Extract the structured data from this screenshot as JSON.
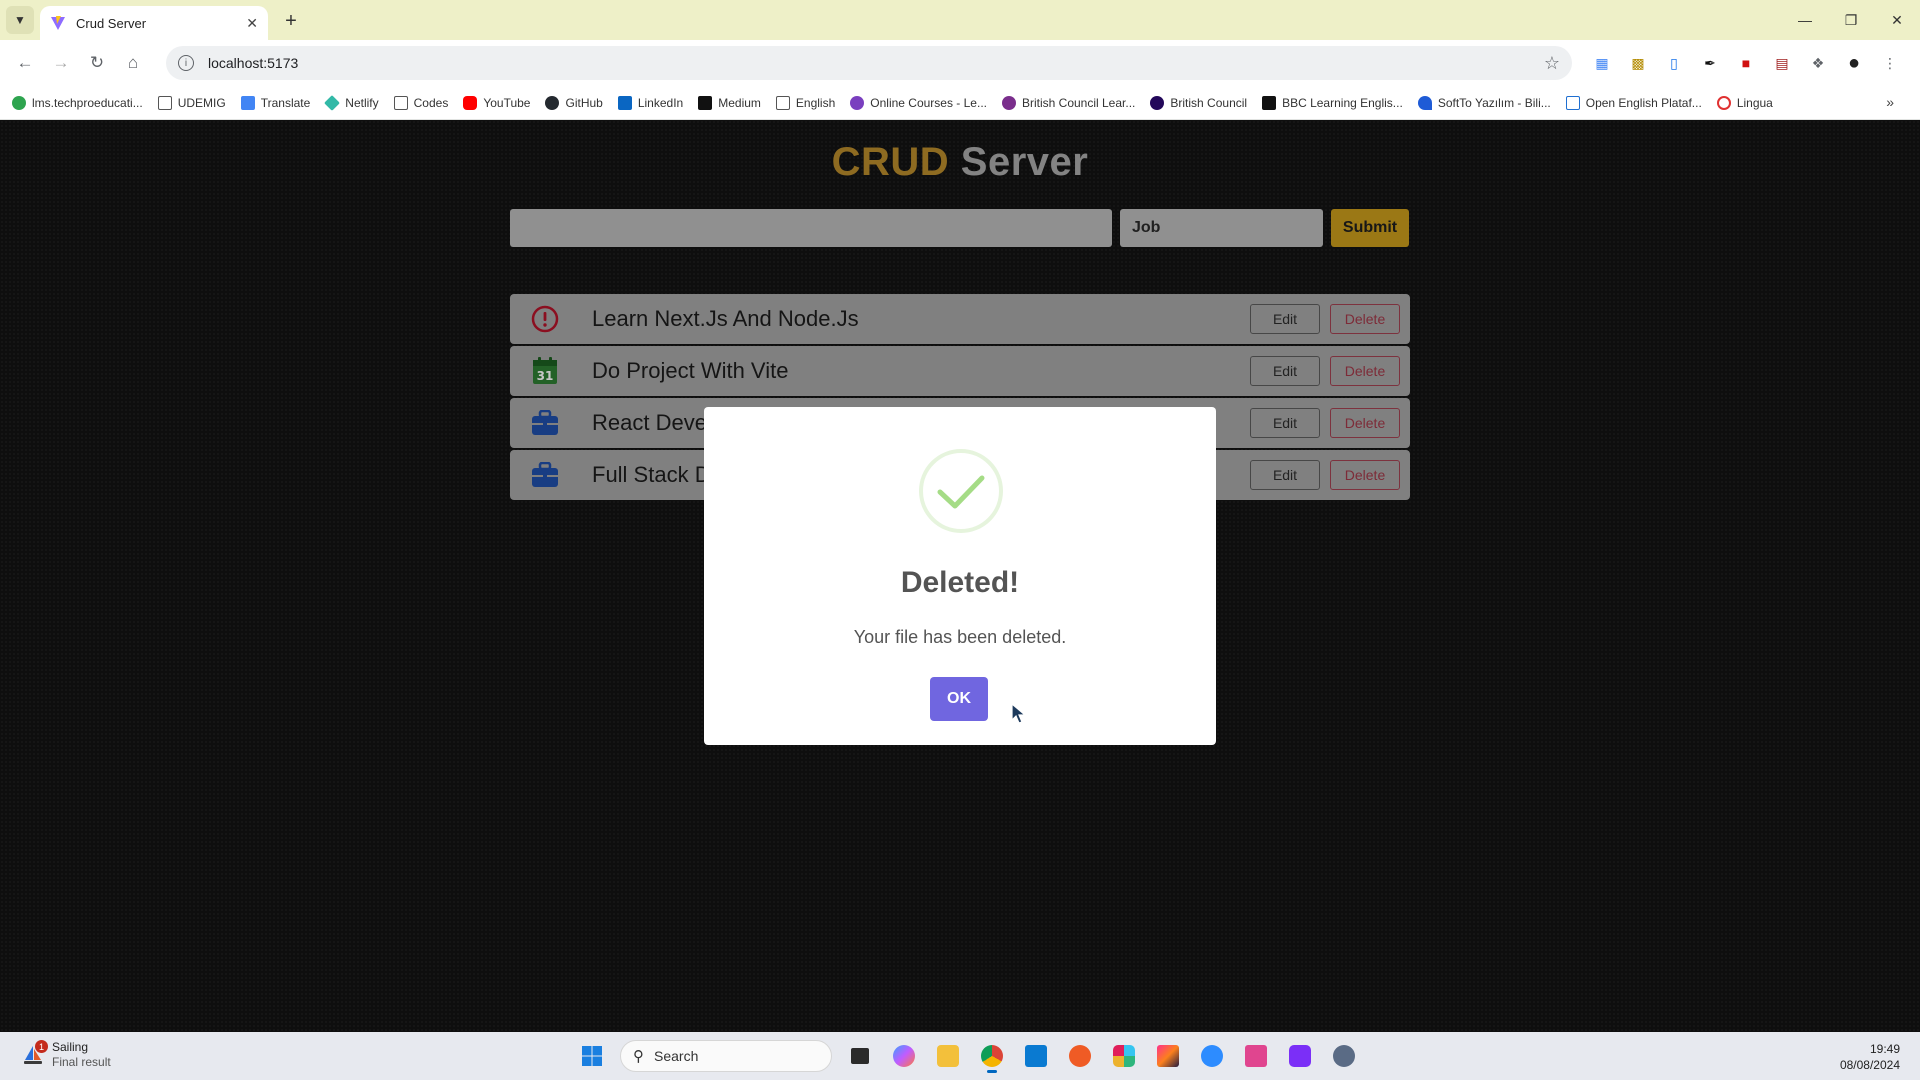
{
  "browser": {
    "tab_title": "Crud Server",
    "url": "localhost:5173",
    "bookmarks": [
      {
        "label": "lms.techproeducati...",
        "color": "#2ea44f"
      },
      {
        "label": "UDEMIG",
        "color": "#777777"
      },
      {
        "label": "Translate",
        "color": "#4285f4"
      },
      {
        "label": "Netlify",
        "color": "#32b9a7"
      },
      {
        "label": "Codes",
        "color": "#777777"
      },
      {
        "label": "YouTube",
        "color": "#ff0000"
      },
      {
        "label": "GitHub",
        "color": "#24292f"
      },
      {
        "label": "LinkedIn",
        "color": "#0a66c2"
      },
      {
        "label": "Medium",
        "color": "#111111"
      },
      {
        "label": "English",
        "color": "#777777"
      },
      {
        "label": "Online Courses - Le...",
        "color": "#7a3fbf"
      },
      {
        "label": "British Council Lear...",
        "color": "#7a2e8c"
      },
      {
        "label": "British Council",
        "color": "#23085a"
      },
      {
        "label": "BBC Learning Englis...",
        "color": "#111111"
      },
      {
        "label": "SoftTo Yazılım - Bili...",
        "color": "#1e5bd6"
      },
      {
        "label": "Open English Plataf...",
        "color": "#1f6fd1"
      },
      {
        "label": "Lingua",
        "color": "#e03131"
      }
    ]
  },
  "app": {
    "title_part1": "CRUD",
    "title_part2": "Server",
    "input_value": "",
    "select_value": "Job",
    "submit_label": "Submit",
    "edit_label": "Edit",
    "delete_label": "Delete",
    "todos": [
      {
        "text": "Learn Next.Js And Node.Js",
        "icon": "alert-circle-icon"
      },
      {
        "text": "Do Project With Vite",
        "icon": "calendar-icon"
      },
      {
        "text": "React Develo",
        "icon": "briefcase-icon"
      },
      {
        "text": "Full Stack De",
        "icon": "briefcase-icon"
      }
    ]
  },
  "modal": {
    "title": "Deleted!",
    "message": "Your file has been deleted.",
    "ok_label": "OK"
  },
  "taskbar": {
    "weather_title": "Sailing",
    "weather_sub": "Final result",
    "weather_badge": "1",
    "search_label": "Search",
    "time": "19:49",
    "date": "08/08/2024"
  },
  "colors": {
    "title_gold": "#b6892b",
    "submit_gold": "#c79a1c",
    "ok_purple": "#7066e0",
    "check_green": "#a5dc86"
  }
}
